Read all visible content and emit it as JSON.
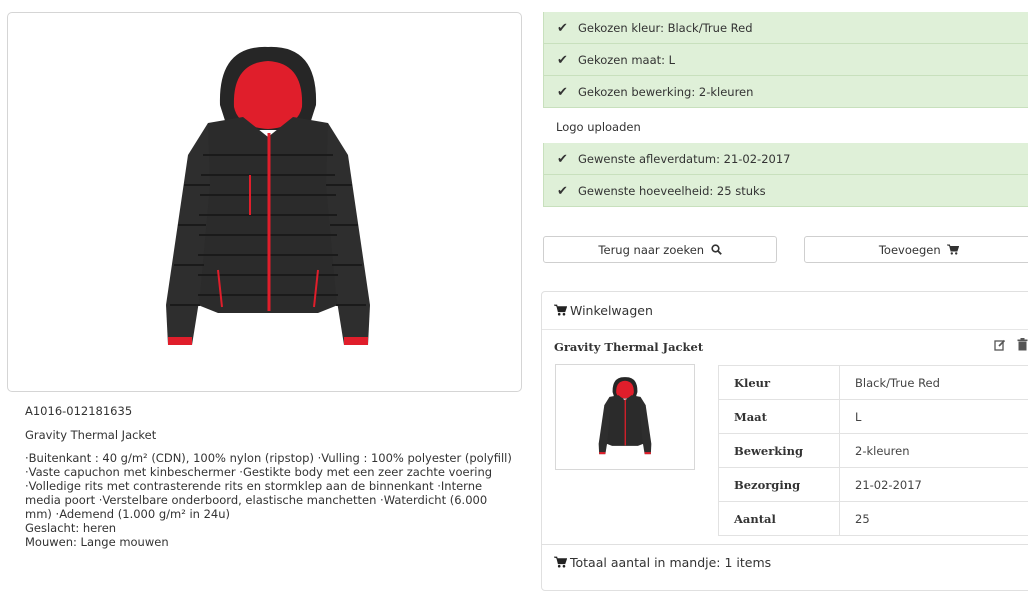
{
  "product": {
    "sku": "A1016-012181635",
    "name": "Gravity Thermal Jacket",
    "description_lines": [
      "·Buitenkant : 40 g/m² (CDN), 100% nylon (ripstop) ·Vulling : 100% polyester (polyfill)",
      "·Vaste capuchon met kinbeschermer ·Gestikte body met een zeer zachte voering",
      "·Volledige rits met contrasterende rits en stormklep aan de binnenkant ·Interne",
      "media poort ·Verstelbare onderboord, elastische manchetten ·Waterdicht (6.000",
      "mm) ·Ademend (1.000 g/m² in 24u)",
      "Geslacht: heren",
      "Mouwen: Lange mouwen"
    ]
  },
  "selections": [
    {
      "text": "Gekozen kleur: Black/True Red",
      "done": true
    },
    {
      "text": "Gekozen maat: L",
      "done": true
    },
    {
      "text": "Gekozen bewerking: 2-kleuren",
      "done": true
    },
    {
      "text": "Logo uploaden",
      "done": false
    },
    {
      "text": "Gewenste afleverdatum: 21-02-2017",
      "done": true
    },
    {
      "text": "Gewenste hoeveelheid: 25 stuks",
      "done": true
    }
  ],
  "buttons": {
    "back_label": "Terug naar zoeken",
    "add_label": "Toevoegen"
  },
  "cart": {
    "title": "Winkelwagen",
    "item": {
      "name": "Gravity Thermal Jacket",
      "details": [
        {
          "label": "Kleur",
          "value": "Black/True Red"
        },
        {
          "label": "Maat",
          "value": "L"
        },
        {
          "label": "Bewerking",
          "value": "2-kleuren"
        },
        {
          "label": "Bezorging",
          "value": "21-02-2017"
        },
        {
          "label": "Aantal",
          "value": "25"
        }
      ]
    },
    "total": "Totaal aantal in mandje: 1 items"
  },
  "icons": {
    "check": "check-icon",
    "search": "search-icon",
    "cart": "cart-icon",
    "edit": "edit-icon",
    "trash": "trash-icon"
  },
  "colors": {
    "success_bg": "#dff0d8",
    "jacket_body": "#262626",
    "jacket_accent": "#e01e2b"
  }
}
